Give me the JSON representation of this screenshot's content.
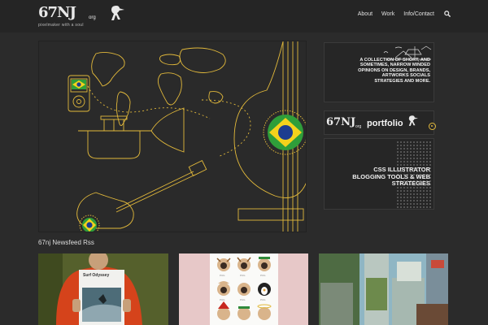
{
  "header": {
    "logo_text": "67NJ",
    "logo_org": "org",
    "tagline": "pixelmaker with a soul",
    "nav": [
      {
        "label": "About"
      },
      {
        "label": "Work"
      },
      {
        "label": "Info/Contact"
      }
    ]
  },
  "sidebar": {
    "top_text": "A COLLECTION OF SHORT, AND SOMETIMES, NARROW MINDED OPINIONS ON DESIGN, BRANDS, ARTWORKS SOCIALS STRATEGIES AND MORE.",
    "portfolio_logo": "67NJ",
    "portfolio_org": "org",
    "portfolio_label": "portfolio",
    "bottom_text": "CSS ILLUSTRATOR BLOGGING TOOLS & WEB STRATEGIES"
  },
  "feed": {
    "title": "67nj Newsfeed Rss",
    "cards": [
      {
        "magazine_title": "Surf Odyssey"
      },
      {
        "pugs": [
          "PUG",
          "PUG",
          "PUG",
          "PUG",
          "PUG",
          "PUG",
          "PUG",
          "PUG",
          "PUG"
        ]
      },
      {}
    ]
  },
  "colors": {
    "accent": "#e2b93b",
    "background": "#2b2b2b",
    "header": "#252525",
    "brazil_green": "#2f9e3a",
    "brazil_yellow": "#f4d21c",
    "brazil_blue": "#1d3d8f"
  }
}
